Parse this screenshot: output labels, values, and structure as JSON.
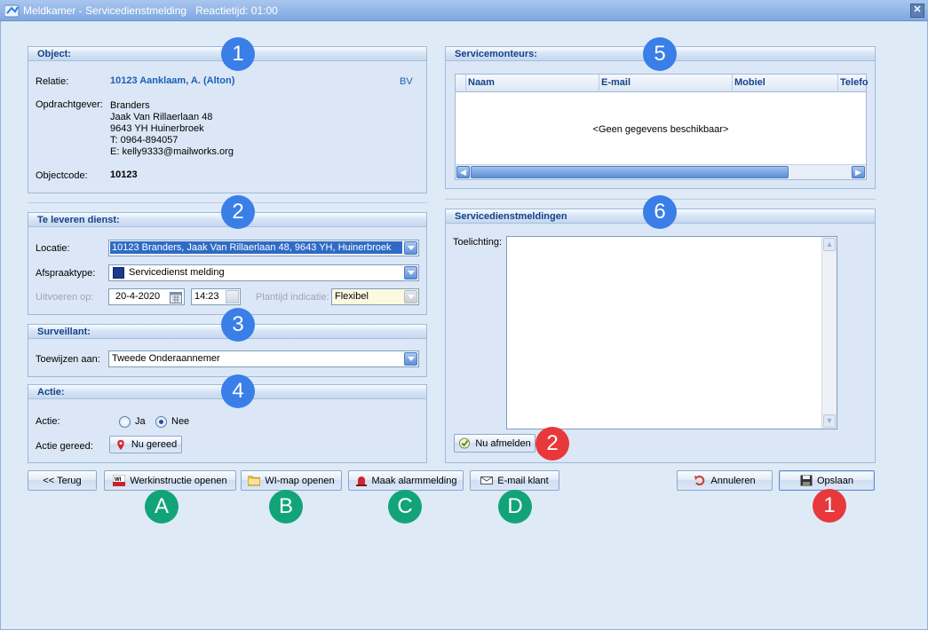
{
  "window": {
    "title": "Meldkamer - Servicedienstmelding",
    "reaction_time": "Reactietijd: 01:00"
  },
  "object": {
    "header": "Object:",
    "relatie_label": "Relatie:",
    "relatie_value": "10123 Aanklaam, A. (Alton)",
    "relatie_tag": "BV",
    "opdrachtgever_label": "Opdrachtgever:",
    "opdrachtgever_lines": [
      "Branders",
      "Jaak Van Rillaerlaan 48",
      "9643 YH  Huinerbroek",
      "T: 0964-894057",
      "E: kelly9333@mailworks.org"
    ],
    "objectcode_label": "Objectcode:",
    "objectcode_value": "10123"
  },
  "dienst": {
    "header": "Te leveren dienst:",
    "locatie_label": "Locatie:",
    "locatie_value": "10123 Branders, Jaak Van Rillaerlaan 48, 9643 YH, Huinerbroek",
    "afspraak_label": "Afspraaktype:",
    "afspraak_value": "Servicedienst melding",
    "uitvoeren_label": "Uitvoeren op:",
    "date_value": "20-4-2020",
    "time_value": "14:23",
    "plantijd_label": "Plantijd indicatie:",
    "plantijd_value": "Flexibel"
  },
  "surveillant": {
    "header": "Surveillant:",
    "toewijzen_label": "Toewijzen aan:",
    "toewijzen_value": "Tweede Onderaannemer"
  },
  "actie": {
    "header": "Actie:",
    "actie_label": "Actie:",
    "ja": "Ja",
    "nee": "Nee",
    "selected": "Nee",
    "gereed_label": "Actie gereed:",
    "gereed_button": "Nu gereed"
  },
  "monteurs": {
    "header": "Servicemonteurs:",
    "columns": [
      "Naam",
      "E-mail",
      "Mobiel",
      "Telefo"
    ],
    "empty": "<Geen gegevens beschikbaar>"
  },
  "meldingen": {
    "header": "Servicedienstmeldingen",
    "toelichting_label": "Toelichting:",
    "toelichting_value": "",
    "afmelden_button": "Nu afmelden"
  },
  "buttons": {
    "terug": "<< Terug",
    "werkinstructie": "Werkinstructie openen",
    "wimap": "WI-map openen",
    "alarm": "Maak alarmmelding",
    "email": "E-mail klant",
    "annuleren": "Annuleren",
    "opslaan": "Opslaan"
  },
  "callouts": {
    "blue": [
      "1",
      "2",
      "3",
      "4",
      "5",
      "6"
    ],
    "red": [
      "2",
      "1"
    ],
    "green": [
      "A",
      "B",
      "C",
      "D"
    ]
  },
  "colors": {
    "callout_blue": "#3a7ee8",
    "callout_red": "#e8383b",
    "callout_green": "#12a478",
    "panel_header_text": "#15428b"
  }
}
